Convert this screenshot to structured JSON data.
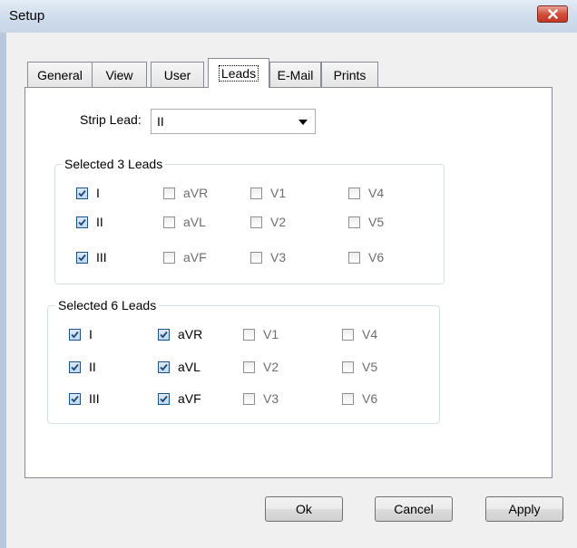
{
  "window": {
    "title": "Setup"
  },
  "tabs": [
    {
      "label": "General",
      "active": false
    },
    {
      "label": "View",
      "active": false
    },
    {
      "label": "User",
      "active": false
    },
    {
      "label": "Leads",
      "active": true
    },
    {
      "label": "E-Mail",
      "active": false
    },
    {
      "label": "Prints",
      "active": false
    }
  ],
  "strip_lead": {
    "label": "Strip Lead:",
    "value": "II"
  },
  "group3": {
    "title": "Selected 3 Leads",
    "items": [
      {
        "label": "I",
        "checked": true
      },
      {
        "label": "aVR",
        "checked": false
      },
      {
        "label": "V1",
        "checked": false
      },
      {
        "label": "V4",
        "checked": false
      },
      {
        "label": "II",
        "checked": true
      },
      {
        "label": "aVL",
        "checked": false
      },
      {
        "label": "V2",
        "checked": false
      },
      {
        "label": "V5",
        "checked": false
      },
      {
        "label": "III",
        "checked": true
      },
      {
        "label": "aVF",
        "checked": false
      },
      {
        "label": "V3",
        "checked": false
      },
      {
        "label": "V6",
        "checked": false
      }
    ]
  },
  "group6": {
    "title": "Selected 6 Leads",
    "items": [
      {
        "label": "I",
        "checked": true
      },
      {
        "label": "aVR",
        "checked": true
      },
      {
        "label": "V1",
        "checked": false
      },
      {
        "label": "V4",
        "checked": false
      },
      {
        "label": "II",
        "checked": true
      },
      {
        "label": "aVL",
        "checked": true
      },
      {
        "label": "V2",
        "checked": false
      },
      {
        "label": "V5",
        "checked": false
      },
      {
        "label": "III",
        "checked": true
      },
      {
        "label": "aVF",
        "checked": true
      },
      {
        "label": "V3",
        "checked": false
      },
      {
        "label": "V6",
        "checked": false
      }
    ]
  },
  "buttons": {
    "ok": "Ok",
    "cancel": "Cancel",
    "apply": "Apply"
  }
}
